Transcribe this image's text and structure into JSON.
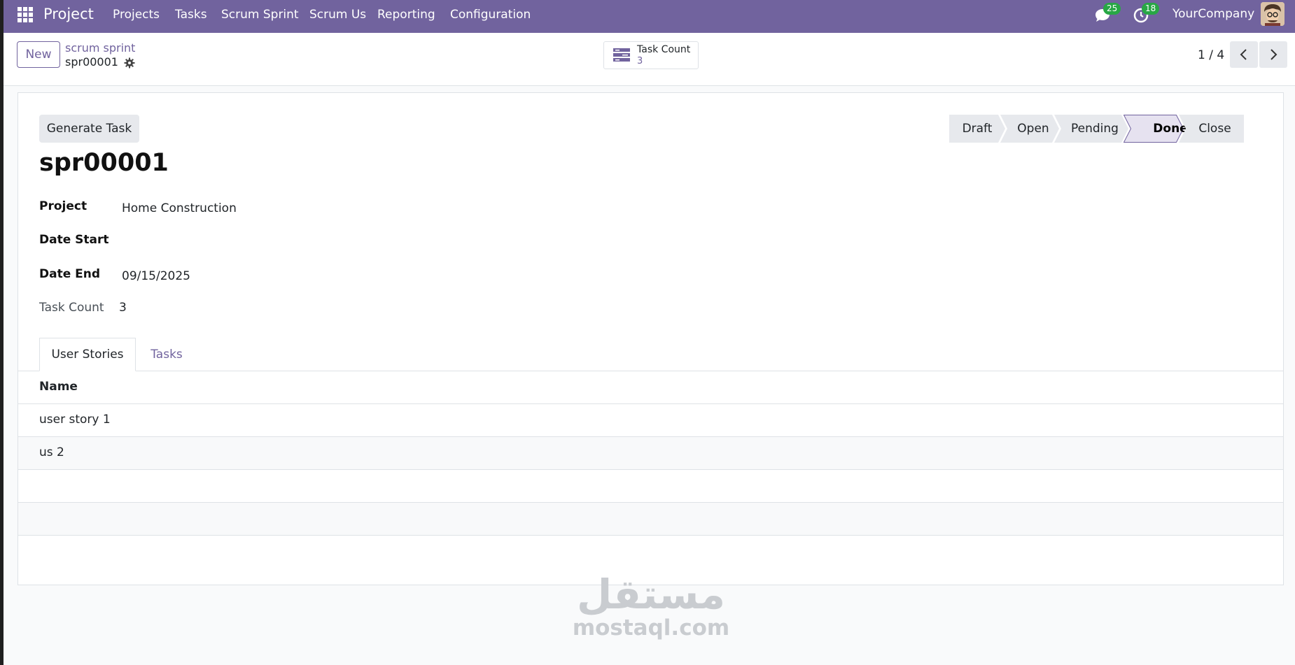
{
  "nav": {
    "app": "Project",
    "menus": [
      "Projects",
      "Tasks",
      "Scrum Sprint",
      "Scrum Us",
      "Reporting",
      "Configuration"
    ],
    "messages_count": "25",
    "activities_count": "18",
    "company": "YourCompany"
  },
  "control": {
    "new_label": "New",
    "breadcrumb_parent": "scrum sprint",
    "breadcrumb_current": "spr00001",
    "smart_label": "Task Count",
    "smart_value": "3",
    "pager": "1 / 4"
  },
  "form": {
    "generate_label": "Generate Task",
    "stages": [
      "Draft",
      "Open",
      "Pending",
      "Done",
      "Close"
    ],
    "active_stage": "Done",
    "title": "spr00001",
    "project_label": "Project",
    "project_value": "Home Construction",
    "date_start_label": "Date Start",
    "date_start_value": "",
    "date_end_label": "Date End",
    "date_end_value": "09/15/2025",
    "task_count_label": "Task Count",
    "task_count_value": "3",
    "tabs": [
      "User Stories",
      "Tasks"
    ],
    "list_header": "Name",
    "rows": [
      "user story 1",
      "us 2"
    ]
  },
  "watermark": {
    "arabic": "مستقل",
    "latin": "mostaql.com"
  },
  "colors": {
    "brand": "#71639e",
    "badge": "#28a745"
  }
}
